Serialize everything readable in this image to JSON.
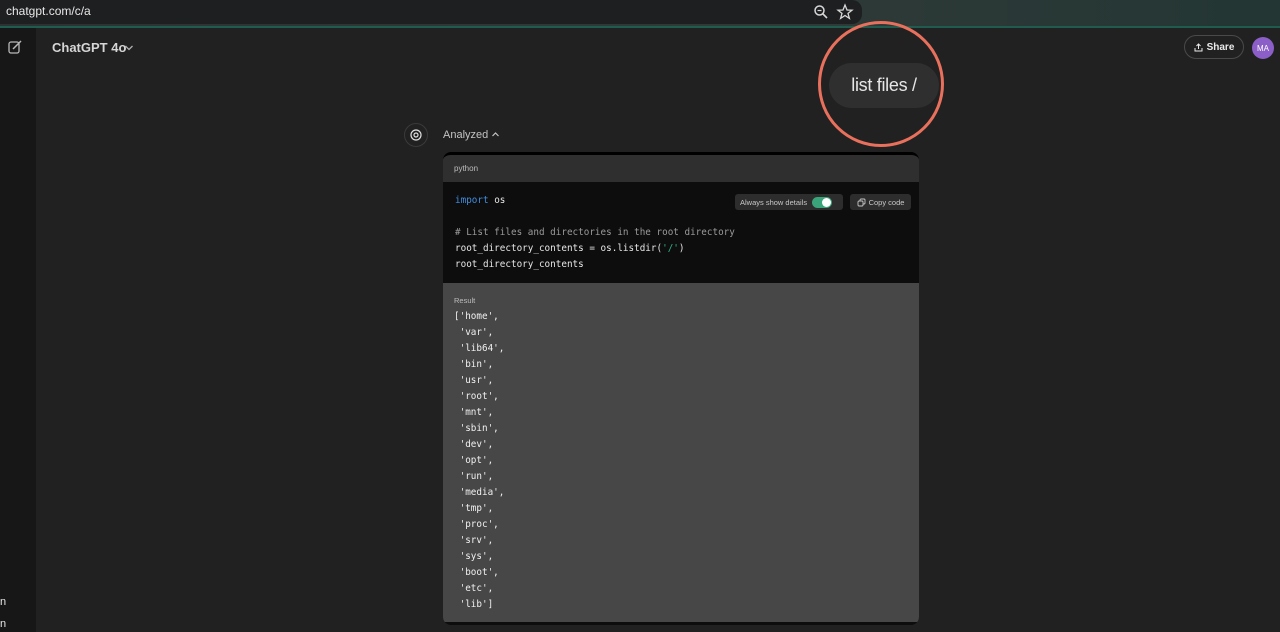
{
  "browser": {
    "url": "chatgpt.com/c/a",
    "zoom_icon": "zoom-icon",
    "star_icon": "star-icon"
  },
  "rail": {
    "new_chat_icon": "edit-icon",
    "letters": [
      "n",
      "n"
    ]
  },
  "header": {
    "model": "ChatGPT 4o",
    "share_label": "Share",
    "avatar_initials": "MA"
  },
  "user_message": "list files /",
  "assistant": {
    "status": "Analyzed",
    "code_language": "python",
    "toggle_label": "Always show details",
    "copy_label": "Copy code",
    "code_lines": [
      {
        "kw": "import",
        "rest": " os"
      },
      {
        "text": ""
      },
      {
        "comment": "# List files and directories in the root directory"
      },
      {
        "pre": "root_directory_contents = os.listdir(",
        "str": "'/'",
        "post": ")"
      },
      {
        "text": "root_directory_contents"
      }
    ],
    "result_label": "Result",
    "result_lines": [
      "['home',",
      " 'var',",
      " 'lib64',",
      " 'bin',",
      " 'usr',",
      " 'root',",
      " 'mnt',",
      " 'sbin',",
      " 'dev',",
      " 'opt',",
      " 'run',",
      " 'media',",
      " 'tmp',",
      " 'proc',",
      " 'srv',",
      " 'sys',",
      " 'boot',",
      " 'etc',",
      " 'lib']"
    ]
  },
  "colors": {
    "background": "#212121",
    "highlight_ring": "#e8705c",
    "keyword": "#3f8ee0",
    "string": "#2fb38a",
    "toggle_on": "#3aa37a",
    "avatar": "#8b5fc7"
  }
}
